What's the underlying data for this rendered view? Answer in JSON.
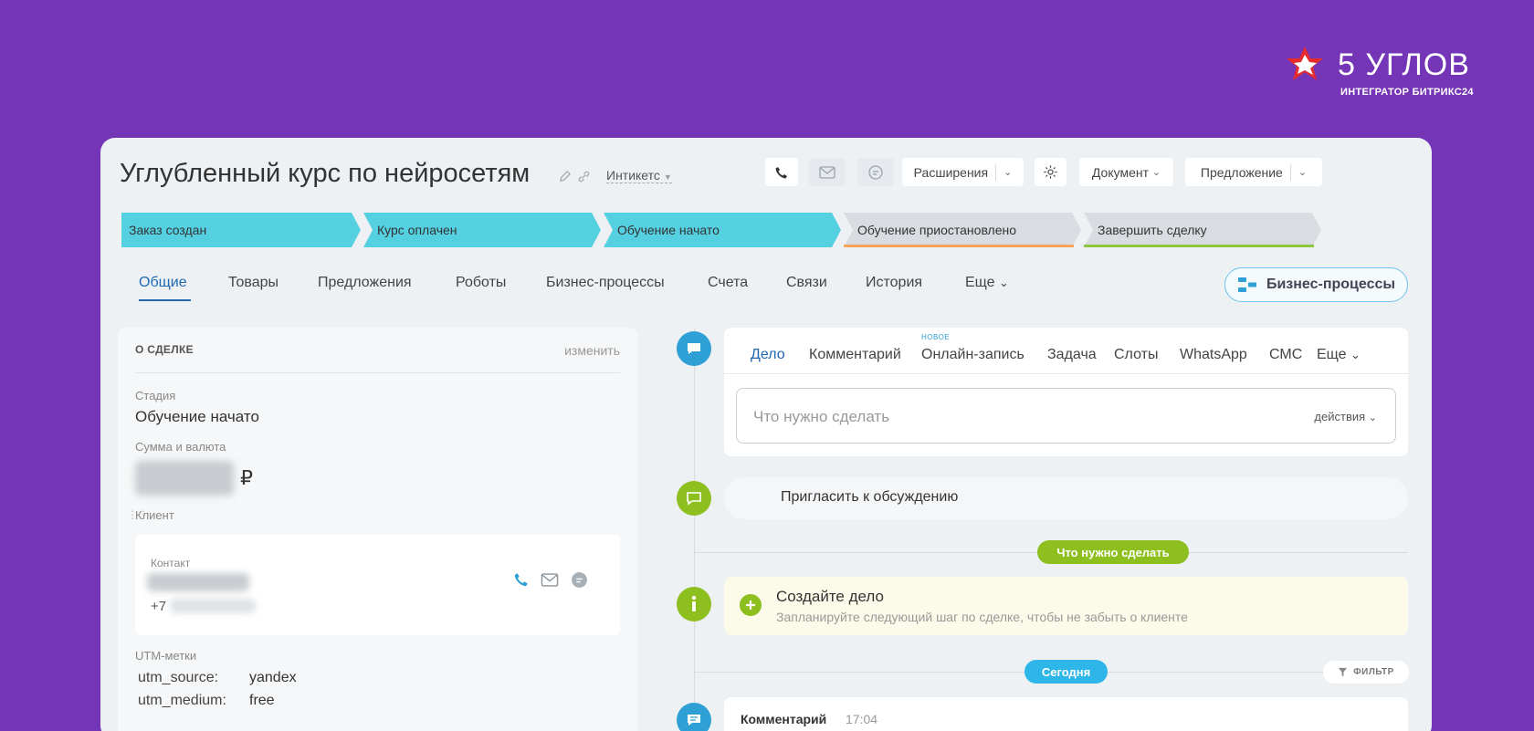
{
  "brand": {
    "title": "5 УГЛОВ",
    "subtitle": "ИНТЕГРАТОР БИТРИКС24",
    "colors": {
      "background": "#7435b6",
      "star": "#e52b2b"
    }
  },
  "deal": {
    "title": "Углубленный курс по нейросетям",
    "company": "Интикетс"
  },
  "toolbar": {
    "extensions": "Расширения",
    "document": "Документ",
    "offer": "Предложение"
  },
  "stages": [
    {
      "label": "Заказ создан",
      "color": "#55d0e0",
      "state": "done"
    },
    {
      "label": "Курс оплачен",
      "color": "#55d0e0",
      "state": "done"
    },
    {
      "label": "Обучение начато",
      "color": "#55d0e0",
      "state": "current"
    },
    {
      "label": "Обучение приостановлено",
      "color": "#d9dde1",
      "underline": "#f5a55a"
    },
    {
      "label": "Завершить сделку",
      "color": "#d9dde1",
      "underline": "#8dc63f"
    }
  ],
  "tabs": [
    {
      "label": "Общие",
      "active": true
    },
    {
      "label": "Товары"
    },
    {
      "label": "Предложения"
    },
    {
      "label": "Роботы"
    },
    {
      "label": "Бизнес-процессы"
    },
    {
      "label": "Счета"
    },
    {
      "label": "Связи"
    },
    {
      "label": "История"
    },
    {
      "label": "Еще"
    }
  ],
  "bp_button": "Бизнес-процессы",
  "about": {
    "heading": "О СДЕЛКЕ",
    "edit": "изменить",
    "stage_label": "Стадия",
    "stage_value": "Обучение начато",
    "sum_label": "Сумма и валюта",
    "currency": "₽",
    "client_label": "Клиент",
    "contact_label": "Контакт",
    "phone_prefix": "+7",
    "utm_label": "UTM-метки",
    "utm": [
      {
        "key": "utm_source:",
        "value": "yandex"
      },
      {
        "key": "utm_medium:",
        "value": "free"
      }
    ]
  },
  "composer": {
    "tabs": [
      "Дело",
      "Комментарий",
      "Онлайн-запись",
      "Задача",
      "Слоты",
      "WhatsApp",
      "СМС",
      "Еще"
    ],
    "new_badge": "НОВОЕ",
    "placeholder": "Что нужно сделать",
    "actions": "действия"
  },
  "timeline": {
    "invite": "Пригласить к обсуждению",
    "todo_pill": "Что нужно сделать",
    "todo_title": "Создайте дело",
    "todo_sub": "Запланируйте следующий шаг по сделке, чтобы не забыть о клиенте",
    "today_pill": "Сегодня",
    "filter": "ФИЛЬТР",
    "comment_title": "Комментарий",
    "comment_time": "17:04"
  }
}
